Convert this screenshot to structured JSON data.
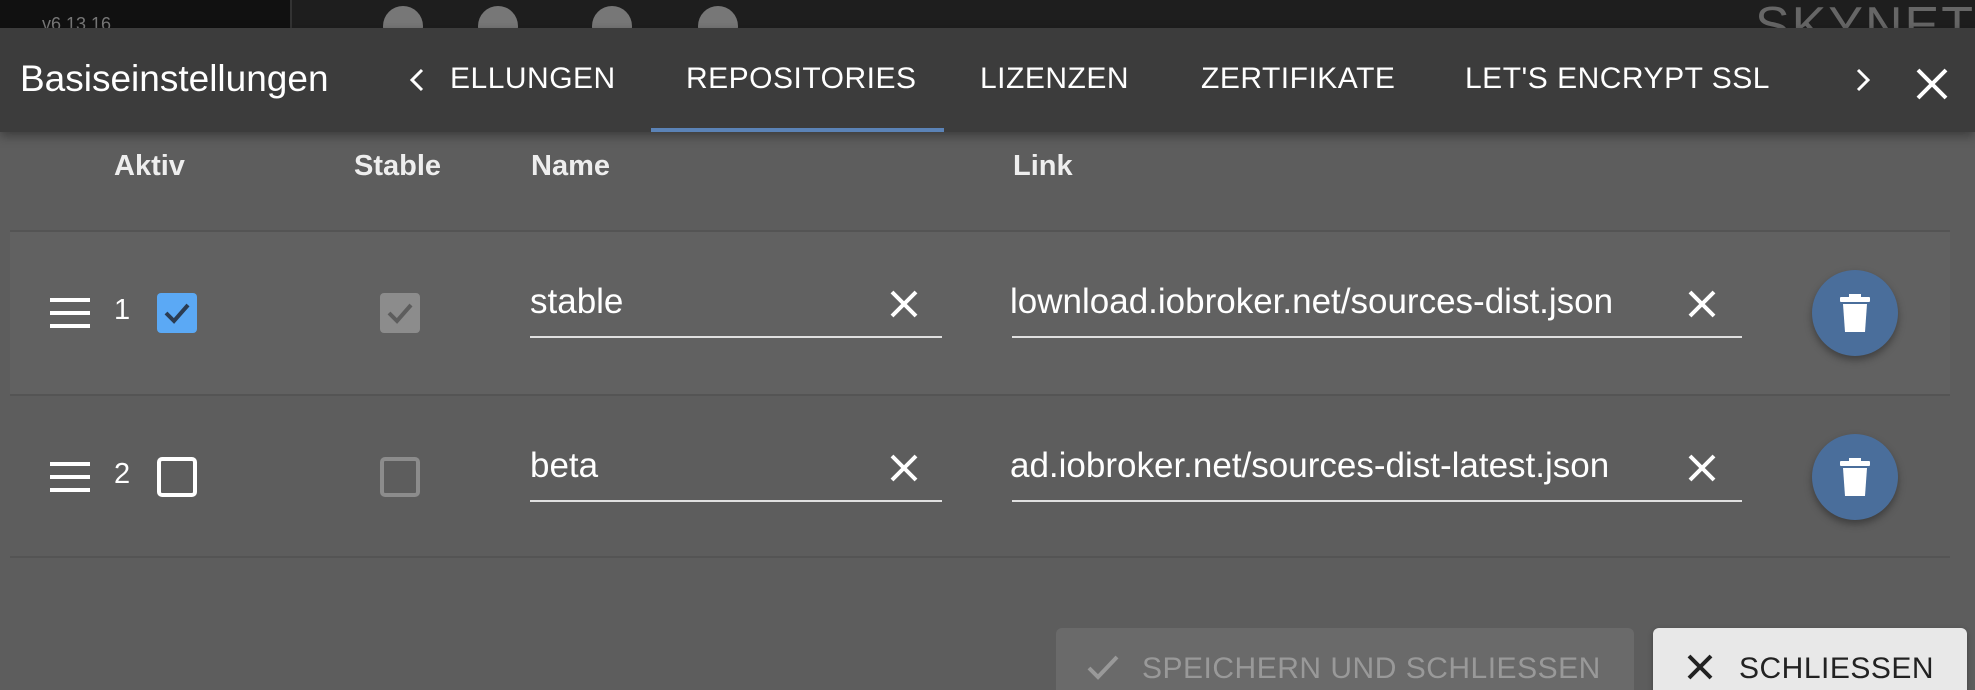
{
  "background": {
    "version": "v6.13.16",
    "brand": "SKYNET"
  },
  "dialog": {
    "title": "Basiseinstellungen",
    "tabs": [
      {
        "label": "ELLUNGEN",
        "active": false
      },
      {
        "label": "REPOSITORIES",
        "active": true
      },
      {
        "label": "LIZENZEN",
        "active": false
      },
      {
        "label": "ZERTIFIKATE",
        "active": false
      },
      {
        "label": "LET'S ENCRYPT SSL",
        "active": false
      }
    ],
    "accent_color": "#5b83b7"
  },
  "table": {
    "columns": {
      "aktiv": "Aktiv",
      "stable": "Stable",
      "name": "Name",
      "link": "Link"
    },
    "rows": [
      {
        "index": "1",
        "active": true,
        "stable": true,
        "name": "stable",
        "link": "http://download.iobroker.net/sources-dist.json",
        "link_visible": "lownload.iobroker.net/sources-dist.json"
      },
      {
        "index": "2",
        "active": false,
        "stable": false,
        "name": "beta",
        "link": "http://download.iobroker.net/sources-dist-latest.json",
        "link_visible": "ad.iobroker.net/sources-dist-latest.json"
      }
    ]
  },
  "footer": {
    "save_label": "SPEICHERN UND SCHLIESSEN",
    "close_label": "SCHLIESSEN"
  }
}
